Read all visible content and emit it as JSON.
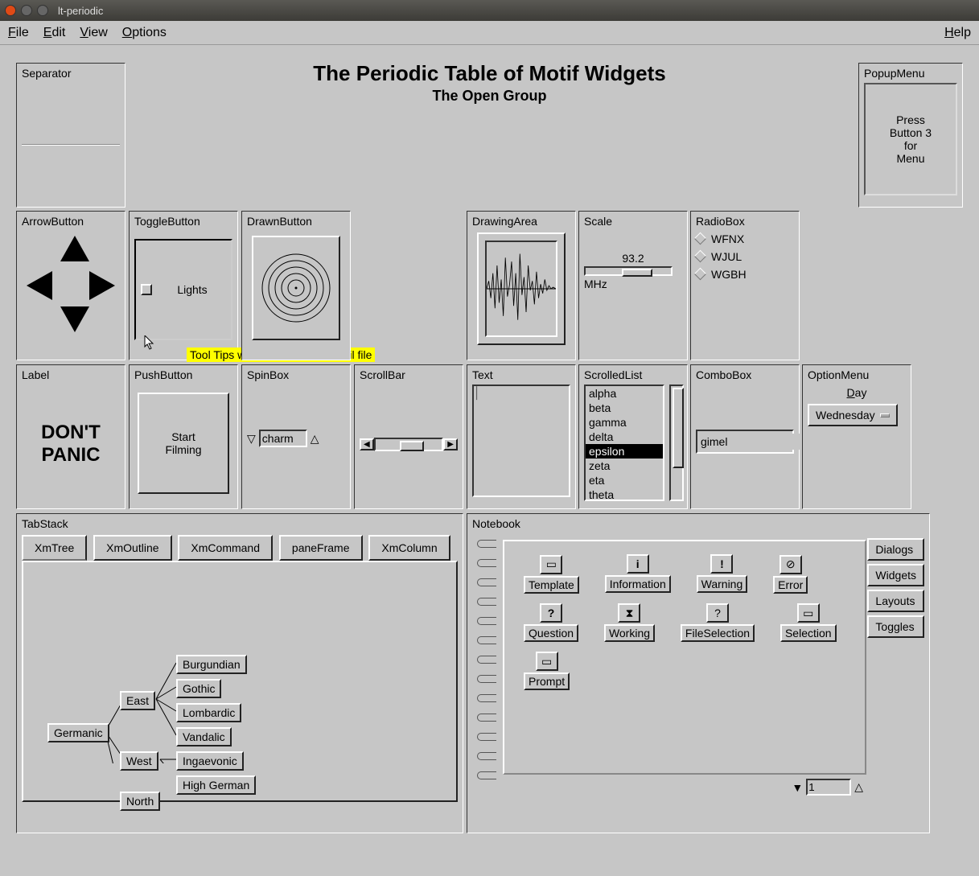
{
  "window_title": "lt-periodic",
  "menubar": {
    "file": "File",
    "edit": "Edit",
    "view": "View",
    "options": "Options",
    "help": "Help"
  },
  "title": "The Periodic Table of Motif Widgets",
  "subtitle": "The Open Group",
  "separator": {
    "title": "Separator"
  },
  "popupmenu": {
    "title": "PopupMenu",
    "text": "Press\nButton 3\nfor\nMenu"
  },
  "arrowbutton": {
    "title": "ArrowButton"
  },
  "togglebutton": {
    "title": "ToggleButton",
    "label": "Lights",
    "tooltip": "Tool Tips work when set in the uil file"
  },
  "drawnbutton": {
    "title": "DrawnButton"
  },
  "drawingarea": {
    "title": "DrawingArea"
  },
  "scale": {
    "title": "Scale",
    "value": "93.2",
    "unit": "MHz"
  },
  "radiobox": {
    "title": "RadioBox",
    "items": [
      "WFNX",
      "WJUL",
      "WGBH"
    ]
  },
  "label": {
    "title": "Label",
    "text": "DON'T\nPANIC"
  },
  "pushbutton": {
    "title": "PushButton",
    "label": "Start\nFilming"
  },
  "spinbox": {
    "title": "SpinBox",
    "value": "charm"
  },
  "scrollbar": {
    "title": "ScrollBar"
  },
  "text": {
    "title": "Text"
  },
  "scrolledlist": {
    "title": "ScrolledList",
    "items": [
      "alpha",
      "beta",
      "gamma",
      "delta",
      "epsilon",
      "zeta",
      "eta",
      "theta"
    ],
    "selected": "epsilon"
  },
  "combobox": {
    "title": "ComboBox",
    "value": "gimel"
  },
  "optionmenu": {
    "title": "OptionMenu",
    "label": "Day",
    "value": "Wednesday"
  },
  "tabstack": {
    "title": "TabStack",
    "tabs": [
      "XmTree",
      "XmOutline",
      "XmCommand",
      "paneFrame",
      "XmColumn"
    ],
    "tree": {
      "root": "Germanic",
      "east": "East",
      "east_children": [
        "Burgundian",
        "Gothic",
        "Lombardic",
        "Vandalic"
      ],
      "west": "West",
      "west_children": [
        "Ingaevonic",
        "High German"
      ],
      "north": "North"
    }
  },
  "notebook": {
    "title": "Notebook",
    "page": "1",
    "tabs": [
      "Dialogs",
      "Widgets",
      "Layouts",
      "Toggles"
    ],
    "items": [
      "Template",
      "Information",
      "Warning",
      "Error",
      "Question",
      "Working",
      "FileSelection",
      "Selection",
      "Prompt"
    ]
  }
}
